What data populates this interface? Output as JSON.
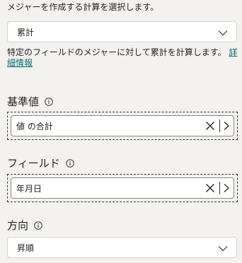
{
  "instruction": "メジャーを作成する計算を選択します。",
  "calculation": {
    "selected": "累計",
    "description": "特定のフィールドのメジャーに対して累計を計算します。",
    "details_link": "詳細情報"
  },
  "base_value": {
    "label": "基準値",
    "value": "値 の合計"
  },
  "field": {
    "label": "フィールド",
    "value": "年月日"
  },
  "direction": {
    "label": "方向",
    "selected": "昇順"
  }
}
